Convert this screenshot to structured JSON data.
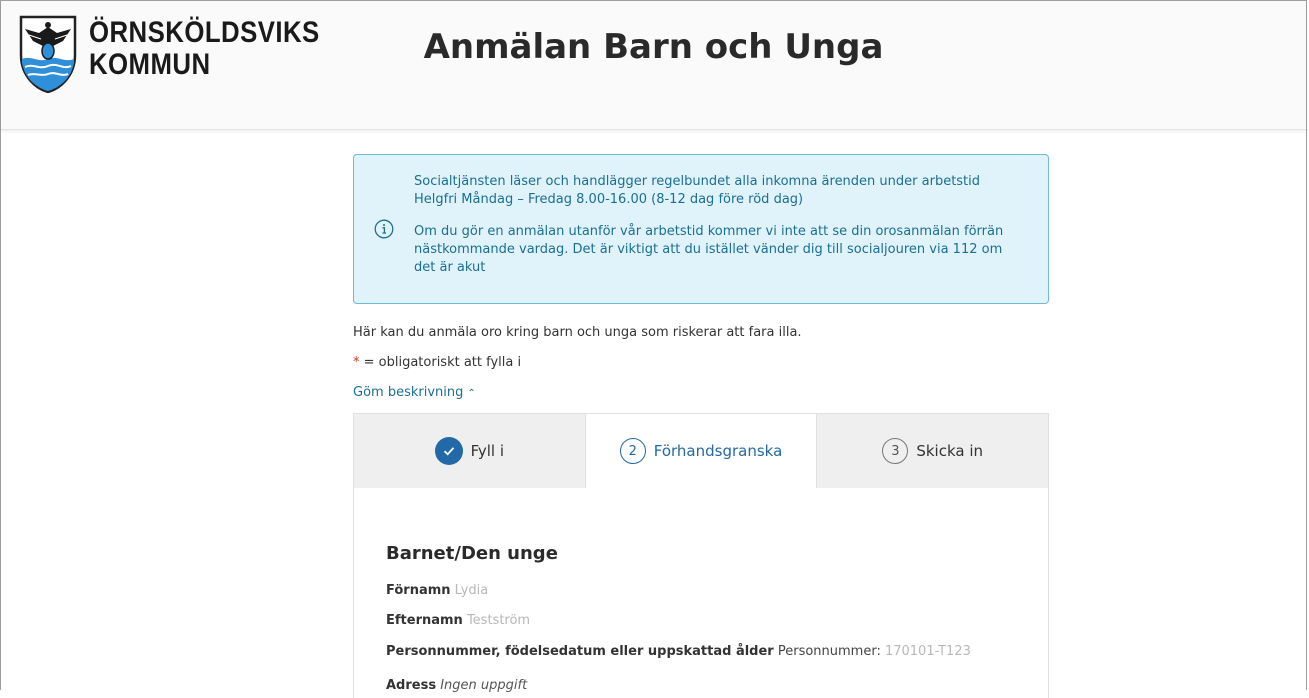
{
  "header": {
    "logo_line1": "ÖRNSKÖLDSVIKS",
    "logo_line2": "KOMMUN",
    "title": "Anmälan Barn och Unga"
  },
  "info": {
    "paragraph1": "Socialtjänsten läser och handlägger regelbundet alla inkomna ärenden under arbetstid Helgfri Måndag – Fredag 8.00-16.00 (8-12 dag före röd dag)",
    "paragraph2": "Om du gör en anmälan utanför vår arbetstid kommer vi inte att se din orosanmälan förrän nästkommande vardag. Det är viktigt att du istället vänder dig till socialjouren via 112 om det är akut"
  },
  "intro": {
    "text": "Här kan du anmäla oro kring barn och unga som riskerar att fara illa.",
    "required_star": "*",
    "required_text": " = obligatoriskt att fylla i",
    "toggle_label": "Göm beskrivning"
  },
  "steps": [
    {
      "number": "✓",
      "label": "Fyll i",
      "state": "done"
    },
    {
      "number": "2",
      "label": "Förhandsgranska",
      "state": "current"
    },
    {
      "number": "3",
      "label": "Skicka in",
      "state": "todo"
    }
  ],
  "section": {
    "title": "Barnet/Den unge",
    "fields": [
      {
        "label": "Förnamn",
        "value": "Lydia"
      },
      {
        "label": "Efternamn",
        "value": "Testström"
      },
      {
        "label": "Personnummer, födelsedatum eller uppskattad ålder",
        "prefix": "Personnummer:",
        "value": "170101-T123"
      },
      {
        "label": "Adress",
        "value": "Ingen uppgift"
      }
    ]
  },
  "colors": {
    "accent": "#2369a8",
    "info_bg": "#e1f3fa",
    "info_border": "#6cb9d8",
    "info_text": "#1a6f94",
    "required": "#d9342b"
  }
}
